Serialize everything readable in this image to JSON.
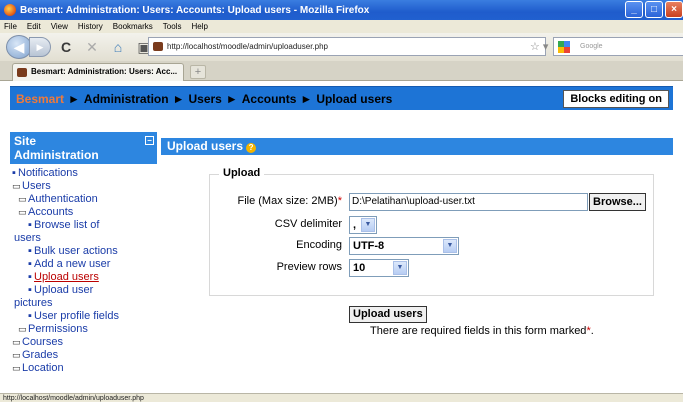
{
  "window": {
    "title": "Besmart: Administration: Users: Accounts: Upload users - Mozilla Firefox",
    "controls": [
      "_",
      "□",
      "×"
    ]
  },
  "menu": [
    "File",
    "Edit",
    "View",
    "History",
    "Bookmarks",
    "Tools",
    "Help"
  ],
  "nav": {
    "url": "http://localhost/moodle/admin/uploaduser.php",
    "search_placeholder": "Google"
  },
  "tab": {
    "label": "Besmart: Administration: Users: Acc...",
    "new_tab": "+"
  },
  "breadcrumb": {
    "site": "Besmart",
    "separator": "►",
    "items": [
      "Administration",
      "Users",
      "Accounts",
      "Upload users"
    ]
  },
  "editing_button": "Blocks editing on",
  "sidebar": {
    "title_line1": "Site",
    "title_line2": "Administration",
    "hide_icon": "−",
    "items": [
      {
        "label": "Notifications",
        "bullet": "▪"
      },
      {
        "label": "Users",
        "bullet": "▭"
      },
      {
        "label": "Authentication",
        "bullet": "▭"
      },
      {
        "label": "Accounts",
        "bullet": "▭"
      },
      {
        "label": "Browse list of",
        "bullet": "▪"
      },
      {
        "label": "users"
      },
      {
        "label": "Bulk user actions",
        "bullet": "▪"
      },
      {
        "label": "Add a new user",
        "bullet": "▪"
      },
      {
        "label": "Upload users",
        "bullet": "▪"
      },
      {
        "label": "Upload user",
        "bullet": "▪"
      },
      {
        "label": "pictures"
      },
      {
        "label": "User profile fields",
        "bullet": "▪"
      },
      {
        "label": "Permissions",
        "bullet": "▭"
      },
      {
        "label": "Courses",
        "bullet": "▭"
      },
      {
        "label": "Grades",
        "bullet": "▭"
      },
      {
        "label": "Location",
        "bullet": "▭"
      }
    ]
  },
  "main": {
    "heading": "Upload users",
    "help_icon": "?",
    "legend": "Upload",
    "file_label": "File (Max size: 2MB)",
    "required_mark": "*",
    "file_value": "D:\\Pelatihan\\upload-user.txt",
    "browse_label": "Browse...",
    "csv_label": "CSV delimiter",
    "csv_value": ",",
    "encoding_label": "Encoding",
    "encoding_value": "UTF-8",
    "preview_label": "Preview rows",
    "preview_value": "10",
    "submit_label": "Upload users",
    "required_note": "There are required fields in this form marked",
    "required_note_end": "."
  },
  "status": "http://localhost/moodle/admin/uploaduser.php"
}
